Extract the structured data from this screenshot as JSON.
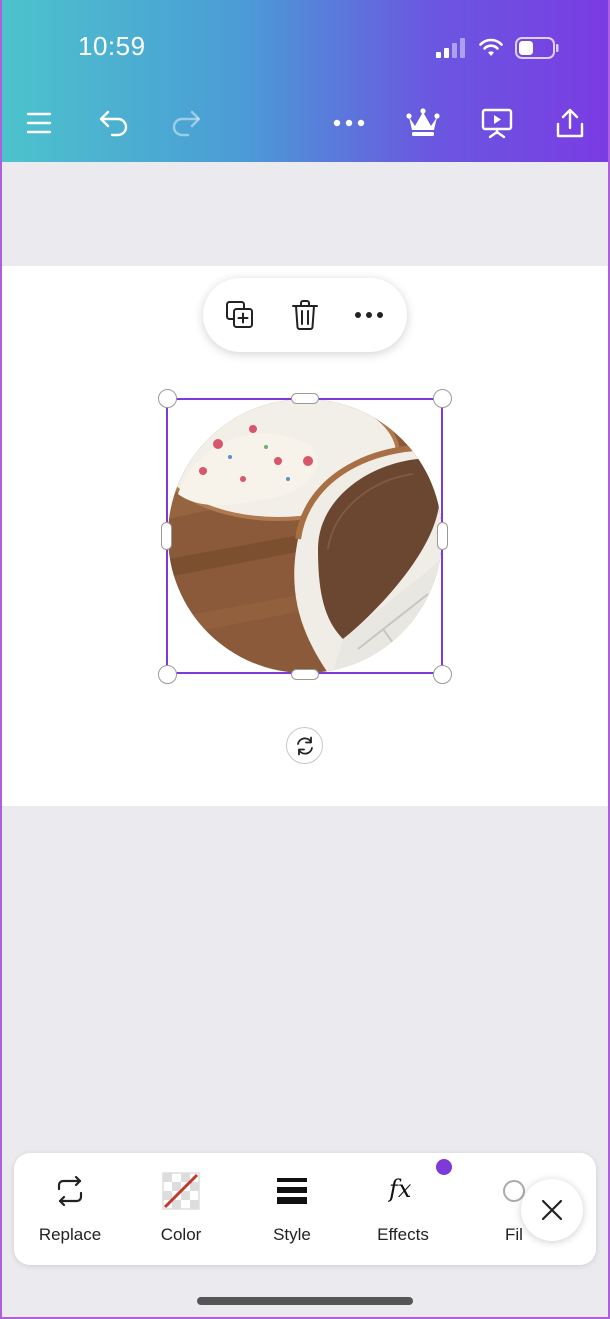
{
  "status_bar": {
    "time": "10:59"
  },
  "top_toolbar": {
    "icons": [
      "menu-icon",
      "undo-icon",
      "redo-icon",
      "more-icon",
      "crown-icon",
      "present-icon",
      "share-icon"
    ]
  },
  "context_menu": {
    "icons": [
      "duplicate-icon",
      "trash-icon",
      "more-icon"
    ]
  },
  "bottom_toolbar": {
    "tools": [
      {
        "label": "Replace",
        "icon": "replace-icon"
      },
      {
        "label": "Color",
        "icon": "color-icon"
      },
      {
        "label": "Style",
        "icon": "style-icon"
      },
      {
        "label": "Effects",
        "icon": "effects-icon"
      },
      {
        "label": "Fil",
        "icon": "filter-icon"
      }
    ]
  },
  "colors": {
    "accent": "#7d3ad8",
    "gradient_start": "#4cc3cc",
    "gradient_end": "#7a3be3"
  }
}
